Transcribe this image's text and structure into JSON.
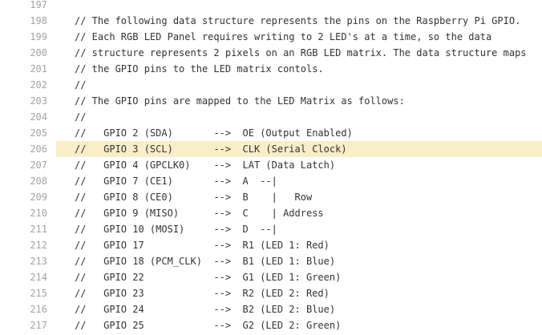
{
  "code_view": {
    "highlighted_line": "206",
    "lines": [
      {
        "number": "197",
        "text": ""
      },
      {
        "number": "198",
        "text": "// The following data structure represents the pins on the Raspberry Pi GPIO."
      },
      {
        "number": "199",
        "text": "// Each RGB LED Panel requires writing to 2 LED's at a time, so the data"
      },
      {
        "number": "200",
        "text": "// structure represents 2 pixels on an RGB LED matrix. The data structure maps"
      },
      {
        "number": "201",
        "text": "// the GPIO pins to the LED matrix contols."
      },
      {
        "number": "202",
        "text": "//"
      },
      {
        "number": "203",
        "text": "// The GPIO pins are mapped to the LED Matrix as follows:"
      },
      {
        "number": "204",
        "text": "//"
      },
      {
        "number": "205",
        "text": "//   GPIO 2 (SDA)       -->  OE (Output Enabled)"
      },
      {
        "number": "206",
        "text": "//   GPIO 3 (SCL)       -->  CLK (Serial Clock)"
      },
      {
        "number": "207",
        "text": "//   GPIO 4 (GPCLK0)    -->  LAT (Data Latch)"
      },
      {
        "number": "208",
        "text": "//   GPIO 7 (CE1)       -->  A  --|"
      },
      {
        "number": "209",
        "text": "//   GPIO 8 (CE0)       -->  B    |   Row"
      },
      {
        "number": "210",
        "text": "//   GPIO 9 (MISO)      -->  C    | Address"
      },
      {
        "number": "211",
        "text": "//   GPIO 10 (MOSI)     -->  D  --|"
      },
      {
        "number": "212",
        "text": "//   GPIO 17            -->  R1 (LED 1: Red)"
      },
      {
        "number": "213",
        "text": "//   GPIO 18 (PCM_CLK)  -->  B1 (LED 1: Blue)"
      },
      {
        "number": "214",
        "text": "//   GPIO 22            -->  G1 (LED 1: Green)"
      },
      {
        "number": "215",
        "text": "//   GPIO 23            -->  R2 (LED 2: Red)"
      },
      {
        "number": "216",
        "text": "//   GPIO 24            -->  B2 (LED 2: Blue)"
      },
      {
        "number": "217",
        "text": "//   GPIO 25            -->  G2 (LED 2: Green)"
      }
    ]
  },
  "colors": {
    "highlight_background": "#f8eec7",
    "line_number": "#a3a3a3",
    "code_text": "#333333"
  }
}
